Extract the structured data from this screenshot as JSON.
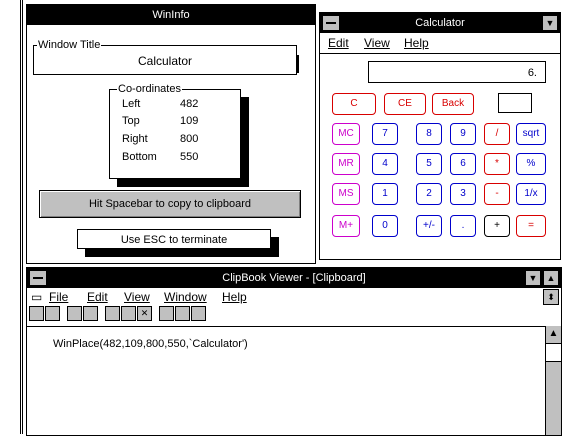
{
  "wininfo": {
    "title": "WinInfo",
    "window_title_group": {
      "legend": "Window Title",
      "value": "Calculator"
    },
    "coords_group": {
      "legend": "Co-ordinates",
      "rows": [
        {
          "label": "Left",
          "value": "482"
        },
        {
          "label": "Top",
          "value": "109"
        },
        {
          "label": "Right",
          "value": "800"
        },
        {
          "label": "Bottom",
          "value": "550"
        }
      ]
    },
    "copy_button": "Hit Spacebar to copy to clipboard",
    "esc_button": "Use ESC to terminate"
  },
  "calculator": {
    "title": "Calculator",
    "menu": [
      "Edit",
      "View",
      "Help"
    ],
    "display": "6.",
    "keys": {
      "clear": "C",
      "clear_entry": "CE",
      "back": "Back",
      "mc": "MC",
      "mr": "MR",
      "ms": "MS",
      "mplus": "M+",
      "k7": "7",
      "k8": "8",
      "k9": "9",
      "div": "/",
      "sqrt": "sqrt",
      "k4": "4",
      "k5": "5",
      "k6": "6",
      "mul": "*",
      "pct": "%",
      "k1": "1",
      "k2": "2",
      "k3": "3",
      "sub": "-",
      "inv": "1/x",
      "k0": "0",
      "sign": "+/-",
      "dot": ".",
      "add": "+",
      "eq": "="
    }
  },
  "clipbook": {
    "title": "ClipBook Viewer - [Clipboard]",
    "menu": [
      "File",
      "Edit",
      "View",
      "Window",
      "Help"
    ],
    "content": "WinPlace(482,109,800,550,`Calculator')"
  }
}
